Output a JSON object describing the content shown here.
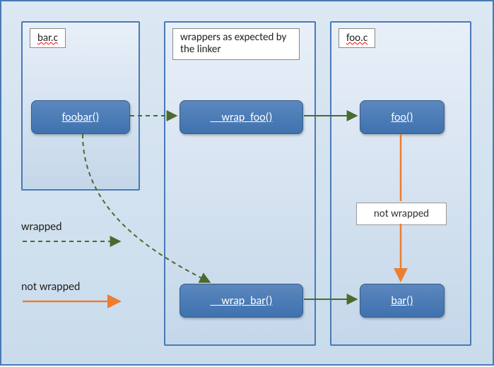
{
  "columns": {
    "bar": {
      "title": "bar.c"
    },
    "wrap": {
      "title": "wrappers as expected by the linker"
    },
    "foo": {
      "title": "foo.c"
    }
  },
  "nodes": {
    "foobar": "foobar()",
    "wrapfoo": "__wrap_foo()",
    "wrapbar": "__wrap_bar()",
    "foo": "foo()",
    "bar": "bar()"
  },
  "edges": {
    "foo_to_bar_label": "not wrapped"
  },
  "legend": {
    "wrapped": "wrapped",
    "notwrapped": "not wrapped"
  }
}
